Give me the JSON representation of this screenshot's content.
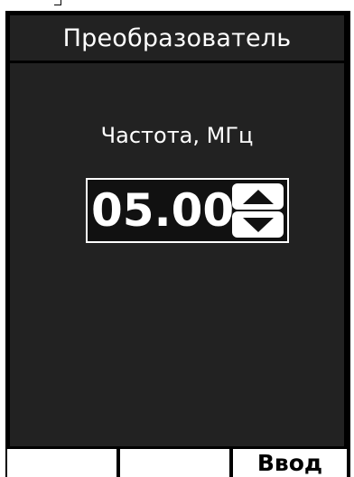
{
  "header": {
    "title": "Преобразователь"
  },
  "main": {
    "field_label": "Частота, МГц",
    "value": "05.00",
    "stepper": {
      "up_icon": "triangle-up-icon",
      "down_icon": "triangle-down-icon"
    }
  },
  "softkeys": {
    "key1_label": "",
    "key2_label": "",
    "key3_label": "Ввод"
  },
  "colors": {
    "background": "#000000",
    "panel": "#222222",
    "text": "#ffffff",
    "softkey": "#ffffff"
  }
}
